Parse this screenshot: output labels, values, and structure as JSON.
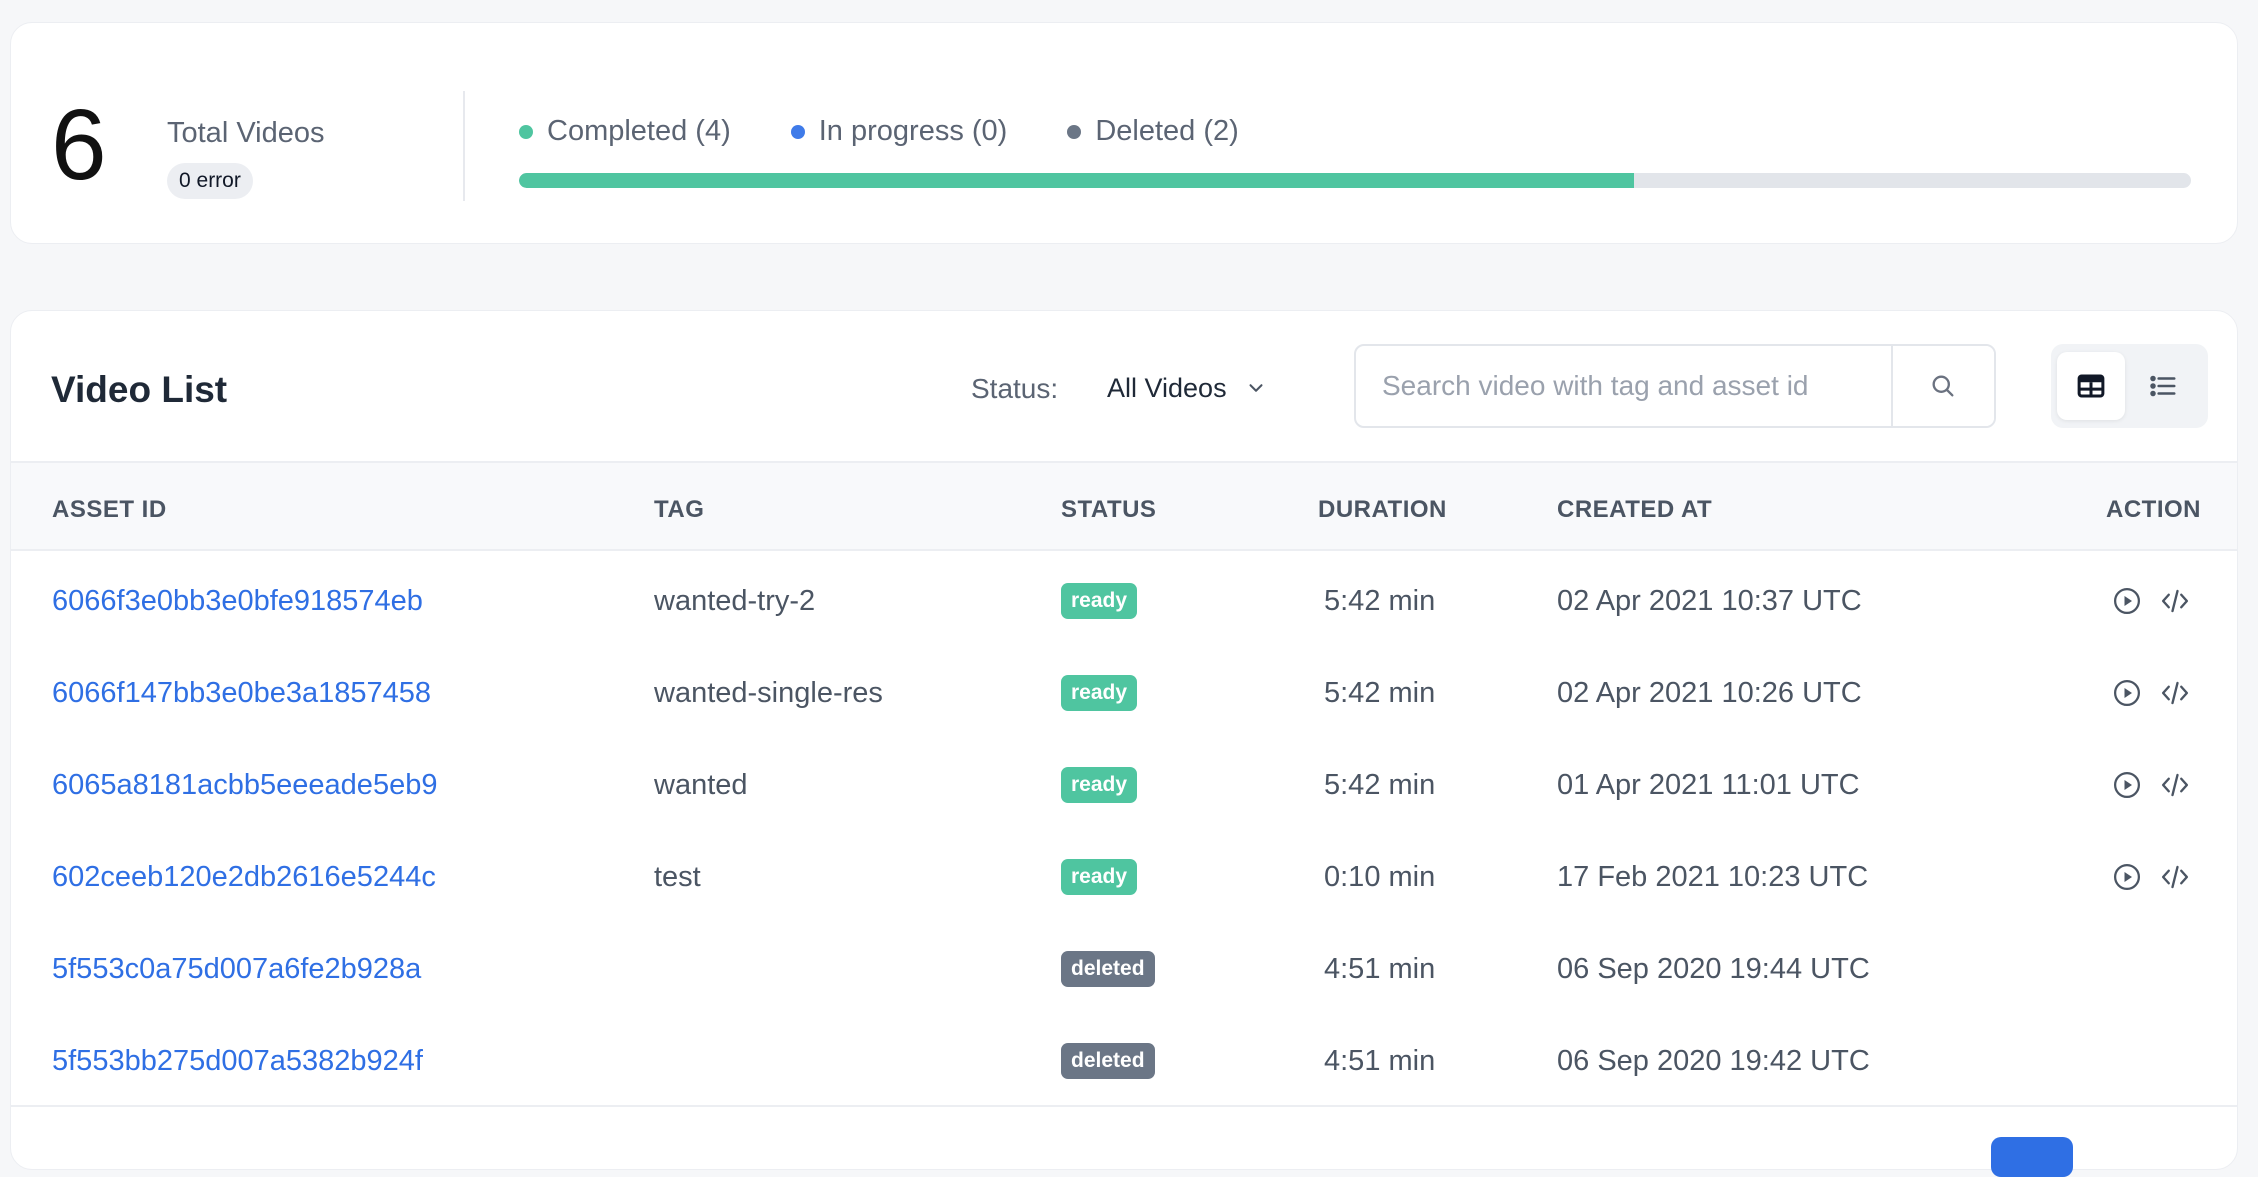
{
  "summary": {
    "total_count": "6",
    "total_label": "Total Videos",
    "error_badge": "0 error",
    "legend": [
      {
        "label": "Completed (4)",
        "color": "#4fc5a0"
      },
      {
        "label": "In progress (0)",
        "color": "#3f7be9"
      },
      {
        "label": "Deleted (2)",
        "color": "#6b7686"
      }
    ],
    "progress": {
      "completed_fraction": 0.667,
      "fill_color": "#4fc5a0",
      "track_color": "#e2e5ea"
    }
  },
  "video_list": {
    "title": "Video List",
    "status_filter": {
      "label": "Status:",
      "selected": "All Videos",
      "icon": "chevron-down-icon"
    },
    "search": {
      "placeholder": "Search video with tag and asset id",
      "value": "",
      "icon": "search-icon"
    },
    "view_toggle": {
      "active": "table-view-icon",
      "options": [
        "table-view-icon",
        "list-view-icon"
      ]
    },
    "columns": {
      "asset_id": "ASSET ID",
      "tag": "TAG",
      "status": "STATUS",
      "duration": "DURATION",
      "created_at": "CREATED AT",
      "action": "ACTION"
    },
    "rows": [
      {
        "asset_id": "6066f3e0bb3e0bfe918574eb",
        "tag": "wanted-try-2",
        "status": "ready",
        "duration": "5:42 min",
        "created_at": "02 Apr 2021 10:37 UTC",
        "actions": [
          "play-icon",
          "embed-code-icon"
        ]
      },
      {
        "asset_id": "6066f147bb3e0be3a1857458",
        "tag": "wanted-single-res",
        "status": "ready",
        "duration": "5:42 min",
        "created_at": "02 Apr 2021 10:26 UTC",
        "actions": [
          "play-icon",
          "embed-code-icon"
        ]
      },
      {
        "asset_id": "6065a8181acbb5eeeade5eb9",
        "tag": "wanted",
        "status": "ready",
        "duration": "5:42 min",
        "created_at": "01 Apr 2021 11:01 UTC",
        "actions": [
          "play-icon",
          "embed-code-icon"
        ]
      },
      {
        "asset_id": "602ceeb120e2db2616e5244c",
        "tag": "test",
        "status": "ready",
        "duration": "0:10 min",
        "created_at": "17 Feb 2021 10:23 UTC",
        "actions": [
          "play-icon",
          "embed-code-icon"
        ]
      },
      {
        "asset_id": "5f553c0a75d007a6fe2b928a",
        "tag": "",
        "status": "deleted",
        "duration": "4:51 min",
        "created_at": "06 Sep 2020 19:44 UTC",
        "actions": []
      },
      {
        "asset_id": "5f553bb275d007a5382b924f",
        "tag": "",
        "status": "deleted",
        "duration": "4:51 min",
        "created_at": "06 Sep 2020 19:42 UTC",
        "actions": []
      }
    ],
    "status_colors": {
      "ready": "#4fc5a0",
      "deleted": "#6b7686"
    },
    "link_color": "#2f6fe4"
  }
}
